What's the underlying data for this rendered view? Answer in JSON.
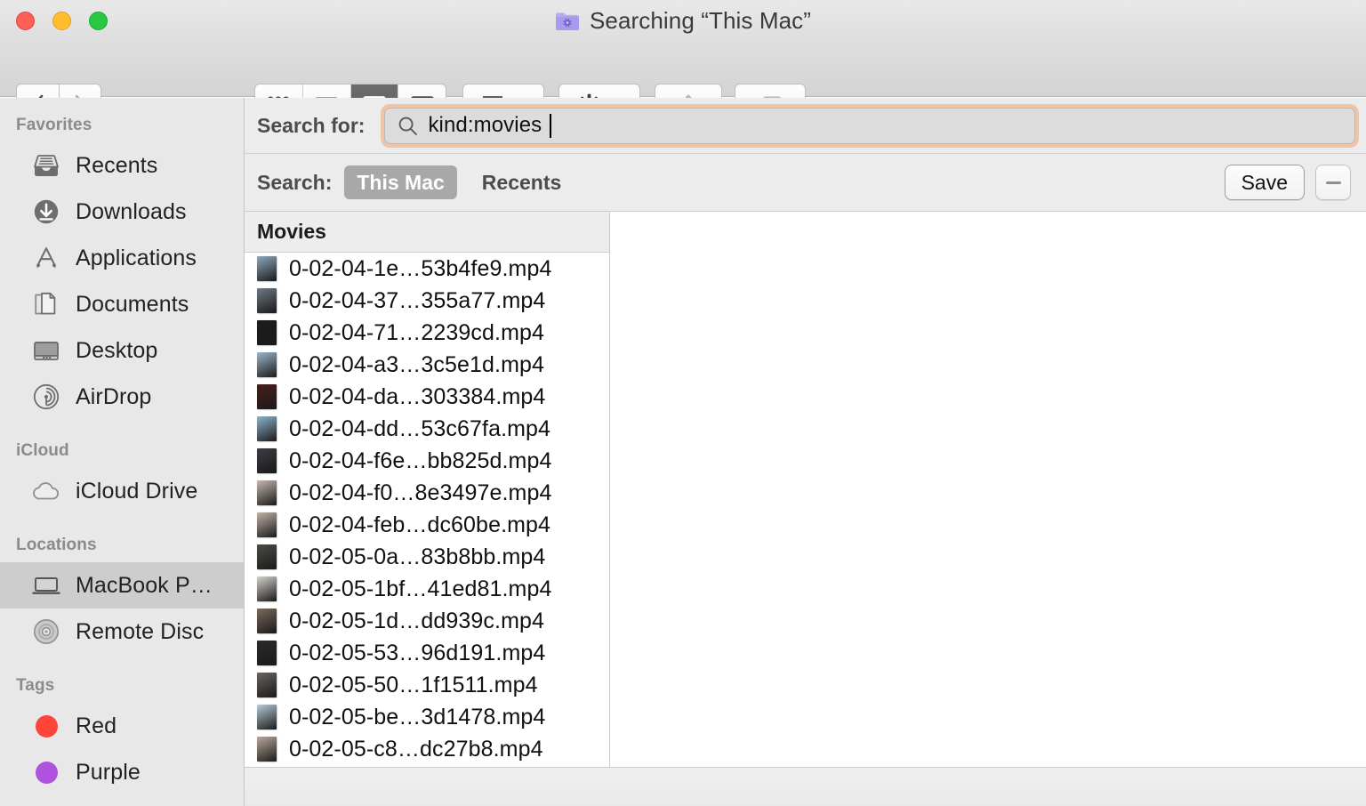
{
  "window": {
    "title": "Searching “This Mac”",
    "title_icon": "smart-folder-icon",
    "traffic_lights": [
      {
        "name": "close",
        "color": "#ff5f56"
      },
      {
        "name": "minimize",
        "color": "#febc2e"
      },
      {
        "name": "zoom",
        "color": "#28c840"
      }
    ]
  },
  "toolbar": {
    "back_icon": "chevron-left-icon",
    "forward_icon": "chevron-right-icon",
    "view_modes": [
      {
        "name": "icon-view",
        "icon": "grid-icon",
        "active": false
      },
      {
        "name": "list-view",
        "icon": "list-icon",
        "active": false
      },
      {
        "name": "column-view",
        "icon": "columns-icon",
        "active": true
      },
      {
        "name": "gallery-view",
        "icon": "gallery-icon",
        "active": false
      }
    ],
    "group_icon": "group-by-icon",
    "group_chevron": "chevron-down-icon",
    "action_icon": "gear-icon",
    "action_chevron": "chevron-down-icon",
    "share_icon": "share-icon",
    "tag_icon": "tag-icon"
  },
  "sidebar": {
    "sections": [
      {
        "header": "Favorites",
        "items": [
          {
            "label": "Recents",
            "icon": "recents-icon",
            "selected": false
          },
          {
            "label": "Downloads",
            "icon": "downloads-icon",
            "selected": false
          },
          {
            "label": "Applications",
            "icon": "applications-icon",
            "selected": false
          },
          {
            "label": "Documents",
            "icon": "documents-icon",
            "selected": false
          },
          {
            "label": "Desktop",
            "icon": "desktop-icon",
            "selected": false
          },
          {
            "label": "AirDrop",
            "icon": "airdrop-icon",
            "selected": false
          }
        ]
      },
      {
        "header": "iCloud",
        "items": [
          {
            "label": "iCloud Drive",
            "icon": "cloud-icon",
            "selected": false
          }
        ]
      },
      {
        "header": "Locations",
        "items": [
          {
            "label": "MacBook P…",
            "icon": "laptop-icon",
            "selected": true
          },
          {
            "label": "Remote Disc",
            "icon": "disc-icon",
            "selected": false
          }
        ]
      },
      {
        "header": "Tags",
        "items": [
          {
            "label": "Red",
            "icon": "tag-dot-icon",
            "color": "#ff453a",
            "selected": false
          },
          {
            "label": "Purple",
            "icon": "tag-dot-icon",
            "color": "#af52de",
            "selected": false
          }
        ]
      }
    ]
  },
  "search": {
    "label": "Search for:",
    "icon": "search-icon",
    "value": "kind:movies",
    "placeholder": "",
    "focus_ring_color": "#f0c4a6",
    "has_caret": true
  },
  "scope": {
    "label": "Search:",
    "options": [
      {
        "label": "This Mac",
        "selected": true
      },
      {
        "label": "Recents",
        "selected": false
      }
    ],
    "save_label": "Save",
    "remove_icon": "minus-icon"
  },
  "columns": {
    "header": "Movies",
    "files": [
      {
        "name": "0-02-04-1e…53b4fe9.mp4",
        "thumb": "#8fa9bd"
      },
      {
        "name": "0-02-04-37…355a77.mp4",
        "thumb": "#6f7a85"
      },
      {
        "name": "0-02-04-71…2239cd.mp4",
        "thumb": "#1c1c1c"
      },
      {
        "name": "0-02-04-a3…3c5e1d.mp4",
        "thumb": "#9cb7cc"
      },
      {
        "name": "0-02-04-da…303384.mp4",
        "thumb": "#4a1d1d"
      },
      {
        "name": "0-02-04-dd…53c67fa.mp4",
        "thumb": "#8fb4cd"
      },
      {
        "name": "0-02-04-f6e…bb825d.mp4",
        "thumb": "#3b3b45"
      },
      {
        "name": "0-02-04-f0…8e3497e.mp4",
        "thumb": "#c8b8ae"
      },
      {
        "name": "0-02-04-feb…dc60be.mp4",
        "thumb": "#c2b3a6"
      },
      {
        "name": "0-02-05-0a…83b8bb.mp4",
        "thumb": "#4d4b46"
      },
      {
        "name": "0-02-05-1bf…41ed81.mp4",
        "thumb": "#d6d2cc"
      },
      {
        "name": "0-02-05-1d…dd939c.mp4",
        "thumb": "#7a6a5c"
      },
      {
        "name": "0-02-05-53…96d191.mp4",
        "thumb": "#2b2b2b"
      },
      {
        "name": "0-02-05-50…1f1511.mp4",
        "thumb": "#6b6560"
      },
      {
        "name": "0-02-05-be…3d1478.mp4",
        "thumb": "#b7ccd8"
      },
      {
        "name": "0-02-05-c8…dc27b8.mp4",
        "thumb": "#b9a99d"
      }
    ]
  }
}
